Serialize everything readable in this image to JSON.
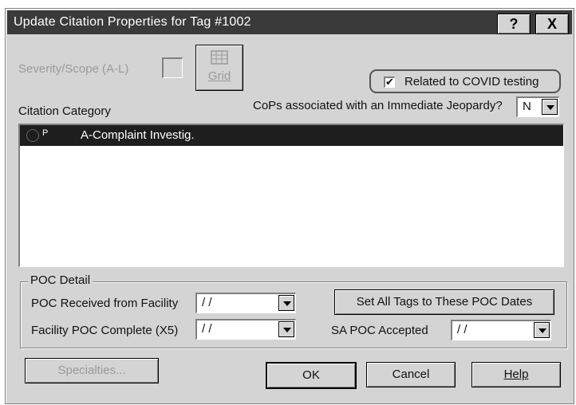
{
  "window": {
    "title": "Update Citation Properties for Tag #1002",
    "help_button": "?",
    "close_button": "X"
  },
  "severity": {
    "label": "Severity/Scope (A-L)",
    "grid_button": "Grid"
  },
  "covid": {
    "checked_mark": "✔",
    "label": "Related to COVID testing"
  },
  "citation_category": {
    "label": "Citation Category",
    "items": [
      {
        "status": "P",
        "text": "A-Complaint Investig."
      }
    ]
  },
  "immediate_jeopardy": {
    "label": "CoPs associated with an Immediate Jeopardy?",
    "value": "N"
  },
  "poc_detail": {
    "group_label": "POC Detail",
    "received_label": "POC Received from Facility",
    "received_value": "/ /",
    "complete_label": "Facility POC Complete (X5)",
    "complete_value": "/ /",
    "set_all_button": "Set All Tags to These POC Dates",
    "sa_accepted_label": "SA POC Accepted",
    "sa_accepted_value": "/ /"
  },
  "footer": {
    "specialties_button": "Specialties...",
    "ok_button": "OK",
    "cancel_button": "Cancel",
    "help_button": "Help"
  },
  "colors": {
    "titlebar": "#3a3a3a",
    "face": "#d4d4d4",
    "selection": "#1e1e1e"
  }
}
